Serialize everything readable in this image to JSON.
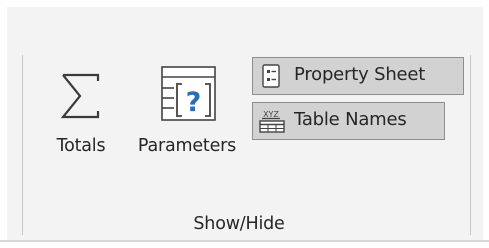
{
  "ribbon": {
    "group_label": "Show/Hide",
    "buttons": {
      "totals": {
        "label": "Totals",
        "icon": "sigma-icon"
      },
      "parameters": {
        "label": "Parameters",
        "icon": "parameters-icon"
      },
      "property_sheet": {
        "label": "Property Sheet",
        "icon": "property-sheet-icon",
        "state": "active"
      },
      "table_names": {
        "label": "Table Names",
        "icon": "table-names-icon",
        "state": "active",
        "icon_text": "XYZ"
      }
    }
  },
  "colors": {
    "group_background": "#f3f3f3",
    "active_button_background": "#d2d2d2",
    "active_button_border": "#8f8f8f",
    "accent_blue": "#2b6cb8",
    "text": "#262626"
  }
}
